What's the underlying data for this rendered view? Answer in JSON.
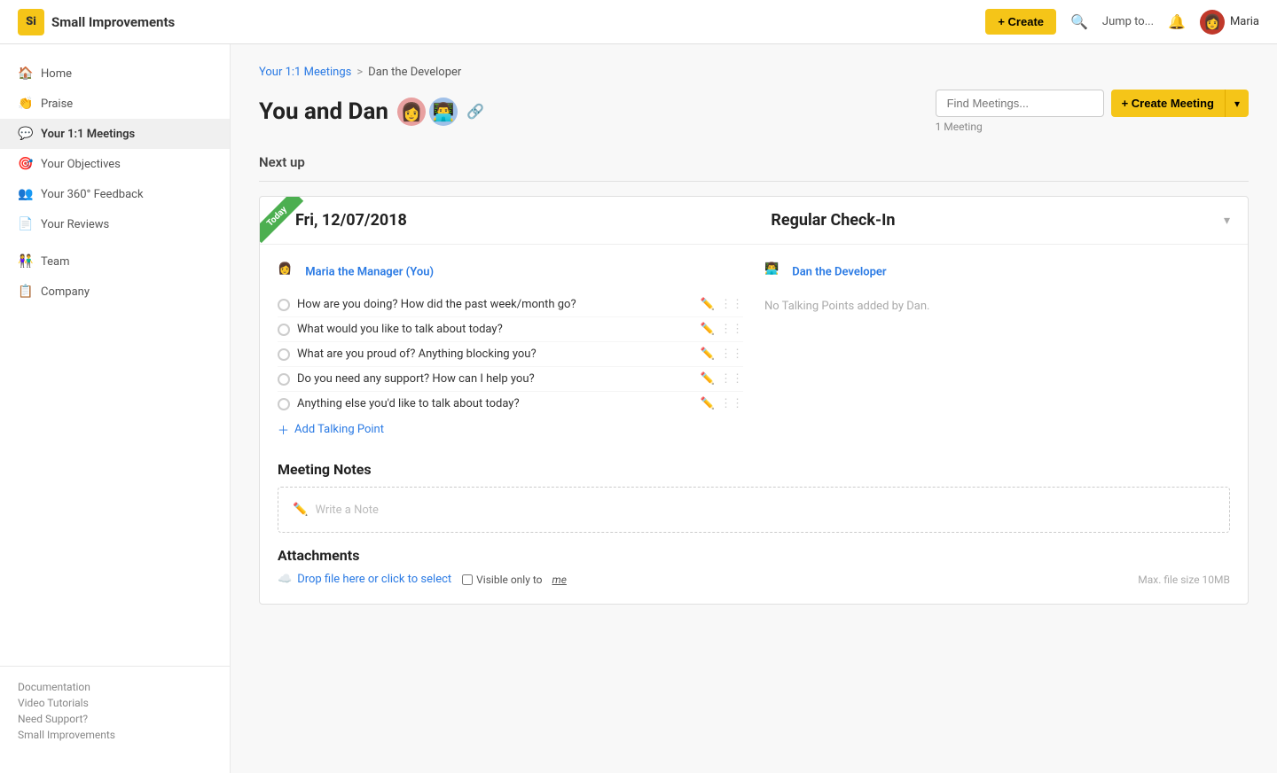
{
  "app": {
    "logo_text": "Si",
    "app_name": "Small Improvements"
  },
  "topnav": {
    "create_label": "+ Create",
    "jump_to_label": "Jump to...",
    "user_name": "Maria"
  },
  "sidebar": {
    "items": [
      {
        "id": "home",
        "label": "Home",
        "icon": "🏠",
        "active": false
      },
      {
        "id": "praise",
        "label": "Praise",
        "icon": "👏",
        "active": false
      },
      {
        "id": "meetings",
        "label": "Your 1:1 Meetings",
        "icon": "💬",
        "active": true
      },
      {
        "id": "objectives",
        "label": "Your Objectives",
        "icon": "🎯",
        "active": false
      },
      {
        "id": "feedback",
        "label": "Your 360° Feedback",
        "icon": "👥",
        "active": false
      },
      {
        "id": "reviews",
        "label": "Your Reviews",
        "icon": "📄",
        "active": false
      },
      {
        "id": "team",
        "label": "Team",
        "icon": "👫",
        "active": false
      },
      {
        "id": "company",
        "label": "Company",
        "icon": "📋",
        "active": false
      }
    ],
    "footer_links": [
      "Documentation",
      "Video Tutorials",
      "Need Support?",
      "Small Improvements"
    ]
  },
  "breadcrumb": {
    "parent_label": "Your 1:1 Meetings",
    "separator": ">",
    "current": "Dan the Developer"
  },
  "page": {
    "title": "You and Dan",
    "find_placeholder": "Find Meetings...",
    "create_meeting_label": "+ Create Meeting",
    "meeting_count": "1 Meeting",
    "section_next_up": "Next up"
  },
  "meeting": {
    "today_label": "Today",
    "date": "Fri, 12/07/2018",
    "type": "Regular Check-In",
    "left_person_name": "Maria the Manager (You)",
    "right_person_name": "Dan the Developer",
    "no_talking_points": "No Talking Points added by Dan.",
    "talking_points": [
      "How are you doing? How did the past week/month go?",
      "What would you like to talk about today?",
      "What are you proud of? Anything blocking you?",
      "Do you need any support? How can I help you?",
      "Anything else you'd like to talk about today?"
    ],
    "add_talking_point_label": "Add Talking Point",
    "notes_section_title": "Meeting Notes",
    "notes_placeholder": "Write a Note",
    "attachments_section_title": "Attachments",
    "drop_label": "Drop file here or click to select",
    "visible_only_label": "Visible only to",
    "visible_me_label": "me",
    "max_file_size": "Max. file size 10MB"
  }
}
